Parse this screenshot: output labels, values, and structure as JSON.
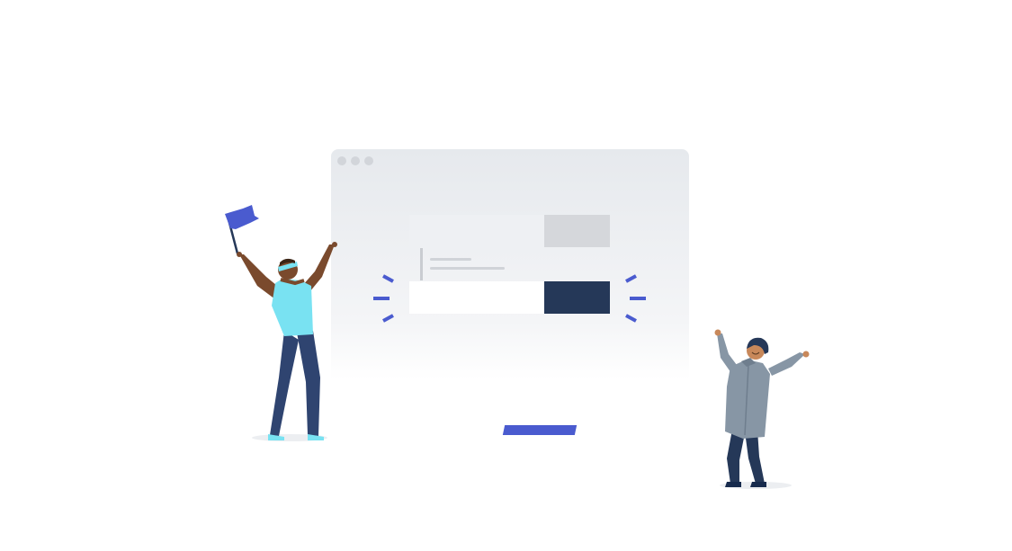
{
  "illustration": {
    "window_dots": 3,
    "colors": {
      "accent_blue": "#4a5bcf",
      "navy": "#253858",
      "light_gray": "#eef0f3",
      "mid_gray": "#d5d7db",
      "shirt_cyan": "#79e2f2",
      "jacket_gray": "#8796a5",
      "skin_dark": "#7a4a2d",
      "skin_light": "#c8885a"
    },
    "icons": [
      "flag-icon",
      "celebration-burst-icon"
    ]
  }
}
